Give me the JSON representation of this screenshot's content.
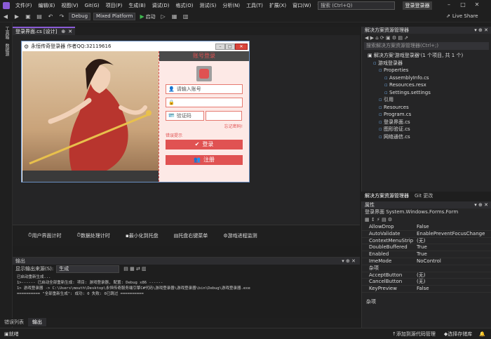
{
  "menu": [
    "文件(F)",
    "编辑(E)",
    "视图(V)",
    "Git(G)",
    "项目(P)",
    "生成(B)",
    "调试(D)",
    "格式(O)",
    "测试(S)",
    "分析(N)",
    "工具(T)",
    "扩展(X)",
    "窗口(W)",
    "帮助(H)"
  ],
  "search": {
    "placeholder": "搜索 (Ctrl+Q)"
  },
  "title_badge": "登录登录器",
  "toolbar": {
    "config": "Debug",
    "platform": "Mixed Platform",
    "start": "启动",
    "live_share": "Live Share"
  },
  "left_strip": [
    "工具箱",
    "数据源"
  ],
  "doc_tab": "登录界面.cs [设计]",
  "form": {
    "title": "永恒传奇登录器 作者QQ:32119616",
    "header": "账号登录",
    "account_placeholder": "请输入账号",
    "password_placeholder": "",
    "captcha_placeholder": "验证码",
    "forgot": "忘记密码!",
    "error_hint": "错误提示",
    "login_btn": "登录",
    "register_btn": "注册"
  },
  "tray": [
    "用户界面计时",
    "数据处理计时",
    "最小化到托盘",
    "托盘右键菜单",
    "游戏进程监测"
  ],
  "output": {
    "title": "输出",
    "source_label": "显示输出来源(S):",
    "source_value": "生成",
    "lines": [
      "已启动重新生成...",
      "1>------ 已启动全部重新生成: 项目: 游戏登录器, 配置: Debug x86 ------",
      "1>  游戏登录器 -> C:\\Users\\mouth\\Desktop\\永恒传奇服务端引擎C#代码\\游戏登录器\\游戏登录器\\bin\\Debug\\游戏登录器.exe",
      "========== \"全部重新生成\": 成功: 0 失败: 0已跳过 =========="
    ]
  },
  "bottom_tabs": [
    "错误列表",
    "输出"
  ],
  "solution": {
    "title": "解决方案资源管理器",
    "search_placeholder": "搜索解决方案资源管理器(Ctrl+;)",
    "root": "解决方案'游戏登录器'(1 个项目, 共 1 个)",
    "items": [
      {
        "label": "游戏登录器",
        "indent": 1
      },
      {
        "label": "Properties",
        "indent": 2
      },
      {
        "label": "AssemblyInfo.cs",
        "indent": 3
      },
      {
        "label": "Resources.resx",
        "indent": 3
      },
      {
        "label": "Settings.settings",
        "indent": 3
      },
      {
        "label": "引用",
        "indent": 2
      },
      {
        "label": "Resources",
        "indent": 2
      },
      {
        "label": "Program.cs",
        "indent": 2
      },
      {
        "label": "登录界面.cs",
        "indent": 2
      },
      {
        "label": "图形验证.cs",
        "indent": 2
      },
      {
        "label": "网络通信.cs",
        "indent": 2
      }
    ],
    "footer_tabs": [
      "解决方案资源管理器",
      "Git 更改"
    ]
  },
  "props": {
    "title": "属性",
    "object": "登录界面 System.Windows.Forms.Form",
    "rows": [
      {
        "name": "AllowDrop",
        "value": "False"
      },
      {
        "name": "AutoValidate",
        "value": "EnablePreventFocusChange"
      },
      {
        "name": "ContextMenuStrip",
        "value": "(无)"
      },
      {
        "name": "DoubleBuffered",
        "value": "True"
      },
      {
        "name": "Enabled",
        "value": "True"
      },
      {
        "name": "ImeMode",
        "value": "NoControl"
      },
      {
        "name": "杂项",
        "value": ""
      },
      {
        "name": "AcceptButton",
        "value": "(无)"
      },
      {
        "name": "CancelButton",
        "value": "(无)"
      },
      {
        "name": "KeyPreview",
        "value": "False"
      }
    ],
    "footer": "杂项"
  },
  "status": {
    "left": "就绪",
    "add_source": "添加到源代码管理",
    "select_repo": "选择存储库"
  }
}
